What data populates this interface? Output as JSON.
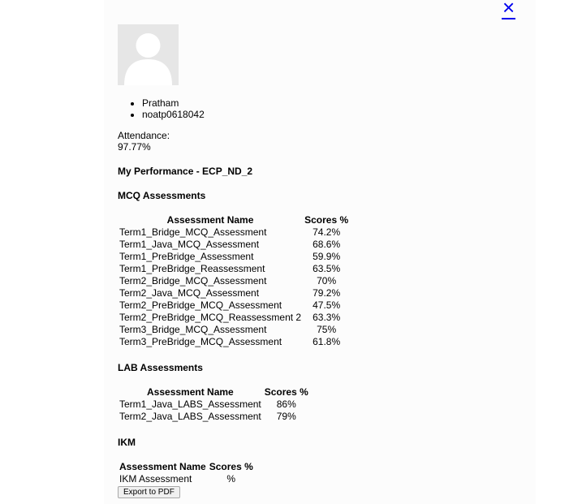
{
  "close_icon": "×",
  "user": {
    "name": "Pratham",
    "id": "noatp0618042"
  },
  "attendance": {
    "label": "Attendance:",
    "value": "97.77%"
  },
  "performance_title": "My Performance - ECP_ND_2",
  "mcq": {
    "title": "MCQ Assessments",
    "headers": [
      "Assessment Name",
      "Scores %"
    ],
    "rows": [
      [
        "Term1_Bridge_MCQ_Assessment",
        "74.2%"
      ],
      [
        "Term1_Java_MCQ_Assessment",
        "68.6%"
      ],
      [
        "Term1_PreBridge_Assessment",
        "59.9%"
      ],
      [
        "Term1_PreBridge_Reassessment",
        "63.5%"
      ],
      [
        "Term2_Bridge_MCQ_Assessment",
        "70%"
      ],
      [
        "Term2_Java_MCQ_Assessment",
        "79.2%"
      ],
      [
        "Term2_PreBridge_MCQ_Assessment",
        "47.5%"
      ],
      [
        "Term2_PreBridge_MCQ_Reassessment 2",
        "63.3%"
      ],
      [
        "Term3_Bridge_MCQ_Assessment",
        "75%"
      ],
      [
        "Term3_PreBridge_MCQ_Assessment",
        "61.8%"
      ]
    ]
  },
  "lab": {
    "title": "LAB Assessments",
    "headers": [
      "Assessment Name",
      "Scores %"
    ],
    "rows": [
      [
        "Term1_Java_LABS_Assessment",
        "86%"
      ],
      [
        "Term2_Java_LABS_Assessment",
        "79%"
      ]
    ]
  },
  "ikm": {
    "title": "IKM",
    "headers": [
      "Assessment Name",
      "Scores %"
    ],
    "rows": [
      [
        "IKM Assessment",
        "%"
      ]
    ]
  },
  "export_label": "Export to PDF"
}
